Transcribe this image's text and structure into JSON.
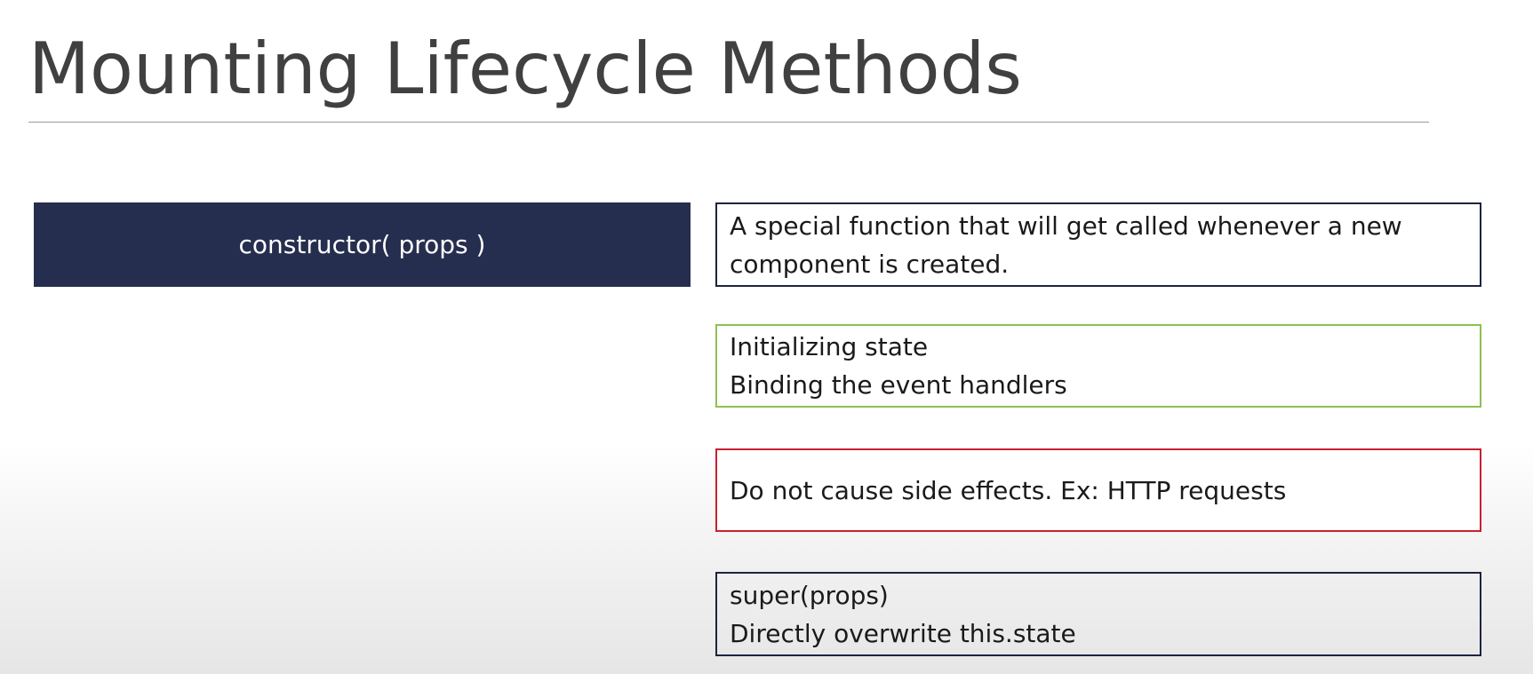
{
  "slide": {
    "title": "Mounting Lifecycle Methods"
  },
  "method": {
    "label": "constructor( props )"
  },
  "notes": {
    "description": "A special function that will get called whenever a new component is created.",
    "uses": [
      "Initializing state",
      "Binding the event handlers"
    ],
    "warning": "Do not cause side effects. Ex: HTTP requests",
    "tips": [
      "super(props)",
      "Directly overwrite this.state"
    ]
  },
  "colors": {
    "method_box": "#262e4f",
    "description_border": "#1e2340",
    "uses_border": "#8cc152",
    "warning_border": "#c8202f",
    "tips_border": "#1e2340"
  }
}
